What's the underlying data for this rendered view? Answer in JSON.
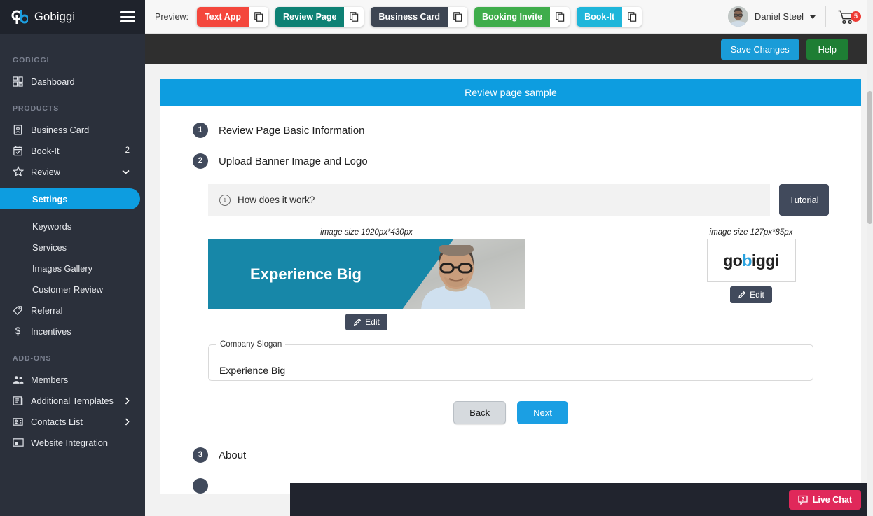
{
  "brand": {
    "name": "Gobiggi",
    "logo_icon": "qb-logo-icon",
    "menu_icon": "hamburger-icon"
  },
  "sidebar": {
    "sections": [
      {
        "label": "GOBIGGI",
        "items": [
          {
            "label": "Dashboard",
            "icon": "dashboard-grid-icon",
            "badge": "",
            "chevron": ""
          }
        ]
      },
      {
        "label": "PRODUCTS",
        "items": [
          {
            "label": "Business Card",
            "icon": "id-card-icon",
            "badge": "",
            "chevron": ""
          },
          {
            "label": "Book-It",
            "icon": "calendar-check-icon",
            "badge": "2",
            "chevron": ""
          },
          {
            "label": "Review",
            "icon": "star-icon",
            "badge": "",
            "chevron": "chevron-down-icon"
          }
        ],
        "subitems": [
          {
            "label": "Settings",
            "active": true
          },
          {
            "label": "Keywords",
            "active": false
          },
          {
            "label": "Services",
            "active": false
          },
          {
            "label": "Images Gallery",
            "active": false
          },
          {
            "label": "Customer Review",
            "active": false
          }
        ],
        "tail_items": [
          {
            "label": "Referral",
            "icon": "tag-icon",
            "badge": "",
            "chevron": ""
          },
          {
            "label": "Incentives",
            "icon": "dollar-icon",
            "badge": "",
            "chevron": ""
          }
        ]
      },
      {
        "label": "ADD-ONS",
        "items": [
          {
            "label": "Members",
            "icon": "users-icon",
            "badge": "",
            "chevron": ""
          },
          {
            "label": "Additional Templates",
            "icon": "templates-icon",
            "badge": "",
            "chevron": "chevron-right-icon"
          },
          {
            "label": "Contacts List",
            "icon": "contact-card-icon",
            "badge": "",
            "chevron": "chevron-right-icon"
          },
          {
            "label": "Website Integration",
            "icon": "browser-window-icon",
            "badge": "",
            "chevron": ""
          }
        ]
      }
    ]
  },
  "topbar": {
    "preview_label": "Preview:",
    "preview_buttons": [
      {
        "label": "Text App",
        "color": "#f4473c",
        "copy_icon": "copy-icon"
      },
      {
        "label": "Review Page",
        "color": "#0e8174",
        "copy_icon": "copy-icon"
      },
      {
        "label": "Business Card",
        "color": "#3d4552",
        "copy_icon": "copy-icon"
      },
      {
        "label": "Booking Invite",
        "color": "#3fad4b",
        "copy_icon": "copy-icon"
      },
      {
        "label": "Book-It",
        "color": "#1fb6da",
        "copy_icon": "copy-icon"
      }
    ],
    "user": {
      "name": "Daniel Steel",
      "avatar_icon": "avatar",
      "caret_icon": "chevron-down-icon"
    },
    "cart": {
      "icon": "shopping-cart-icon",
      "badge": "5",
      "badge_color": "#ee3b35"
    }
  },
  "actionbar": {
    "save_label": "Save Changes",
    "help_label": "Help",
    "save_color": "#1a9cd8",
    "help_color": "#1e7e34"
  },
  "card": {
    "header": "Review page sample",
    "header_color": "#0d9de0",
    "steps": [
      {
        "num": "1",
        "title": "Review Page Basic Information"
      },
      {
        "num": "2",
        "title": "Upload Banner Image and Logo"
      },
      {
        "num": "3",
        "title": "About"
      }
    ],
    "how_it_works": {
      "text": "How does it work?",
      "info_icon": "info-icon",
      "tutorial_label": "Tutorial"
    },
    "banner": {
      "size_caption": "image size 1920px*430px",
      "headline": "Experience Big",
      "edit_label": "Edit",
      "edit_icon": "pencil-icon"
    },
    "logo": {
      "size_caption": "image size 127px*85px",
      "text_part1": "go",
      "text_highlight": "b",
      "text_part2": "iggi",
      "highlight_color": "#2aa3e0",
      "edit_label": "Edit",
      "edit_icon": "pencil-icon"
    },
    "slogan_field": {
      "legend": "Company Slogan",
      "value": "Experience Big"
    },
    "nav": {
      "back_label": "Back",
      "next_label": "Next"
    }
  },
  "bottombar": {
    "livechat_label": "Live Chat",
    "livechat_icon": "chat-question-icon",
    "livechat_color": "#e0285a"
  }
}
